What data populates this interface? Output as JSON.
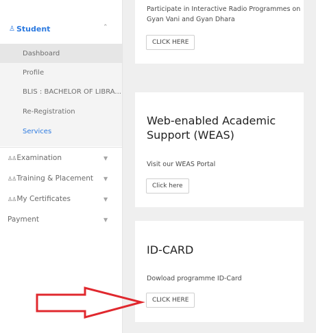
{
  "sidebar": {
    "student_label": "Student",
    "student_icon": "user-icon",
    "submenu": [
      {
        "label": "Dashboard",
        "active": true
      },
      {
        "label": "Profile"
      },
      {
        "label": "BLIS : BACHELOR OF LIBRA..."
      },
      {
        "label": "Re-Registration"
      },
      {
        "label": "Services"
      }
    ],
    "menu": [
      {
        "label": "Examination",
        "icon": "users-icon"
      },
      {
        "label": "Training & Placement",
        "icon": "users-icon"
      },
      {
        "label": "My Certificates",
        "icon": "users-icon"
      },
      {
        "label": "Payment"
      }
    ]
  },
  "cards": {
    "radio": {
      "text": "Participate in Interactive Radio Programmes on Gyan Vani and Gyan Dhara",
      "button": "CLICK HERE"
    },
    "weas": {
      "title": "Web-enabled Academic Support (WEAS)",
      "text": "Visit our WEAS Portal",
      "button": "Click here"
    },
    "idcard": {
      "title": "ID-CARD",
      "text": "Dowload programme ID-Card",
      "button": "CLICK HERE"
    }
  },
  "colors": {
    "accent": "#2c7ae0",
    "arrow": "#e0282e"
  }
}
